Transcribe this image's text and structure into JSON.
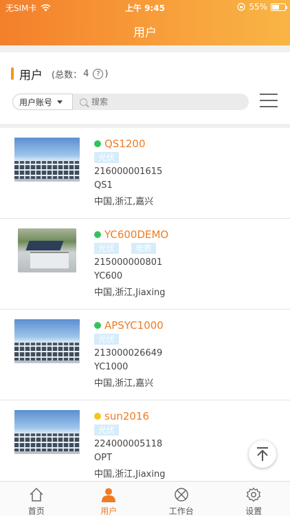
{
  "status_bar": {
    "carrier": "无SIM卡",
    "time": "上午 9:45",
    "battery": "55%",
    "battery_level": 0.55
  },
  "header": {
    "title": "用户"
  },
  "section": {
    "title": "用户",
    "count_label": "(总数：",
    "count": "4",
    "count_close": ")",
    "help": "?"
  },
  "search": {
    "filter_label": "用户账号",
    "placeholder": "搜索"
  },
  "users": [
    {
      "name": "QS1200",
      "status_color": "#36c25b",
      "tags": [
        "光伏"
      ],
      "id": "216000001615",
      "model": "QS1",
      "location": "中国,浙江,嘉兴",
      "thumb": "sky"
    },
    {
      "name": "YC600DEMO",
      "status_color": "#36c25b",
      "tags": [
        "光伏",
        "电表"
      ],
      "id": "215000000801",
      "model": "YC600",
      "location": "中国,浙江,Jiaxing",
      "thumb": "bldg"
    },
    {
      "name": "APSYC1000",
      "status_color": "#36c25b",
      "tags": [
        "光伏"
      ],
      "id": "213000026649",
      "model": "YC1000",
      "location": "中国,浙江,嘉兴",
      "thumb": "sky"
    },
    {
      "name": "sun2016",
      "status_color": "#f5c518",
      "tags": [
        "光伏"
      ],
      "id": "224000005118",
      "model": "OPT",
      "location": "中国,浙江,Jiaxing",
      "thumb": "sky"
    }
  ],
  "tabbar": {
    "items": [
      {
        "label": "首页",
        "icon": "home-icon"
      },
      {
        "label": "用户",
        "icon": "user-icon",
        "active": true
      },
      {
        "label": "工作台",
        "icon": "workbench-icon"
      },
      {
        "label": "设置",
        "icon": "settings-icon"
      }
    ]
  },
  "colors": {
    "accent": "#f47f2b",
    "tag_bg": "#d5ecfb",
    "name": "#ef7b22"
  }
}
